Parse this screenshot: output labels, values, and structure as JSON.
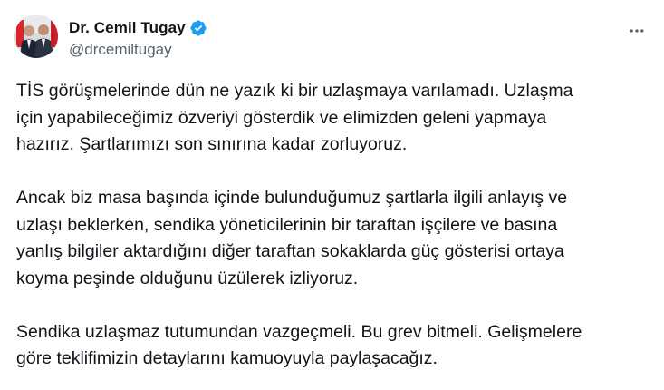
{
  "author": {
    "display_name": "Dr. Cemil Tugay",
    "handle": "@drcemiltugay",
    "verified": true,
    "verified_color": "#1d9bf0"
  },
  "menu": {
    "icon": "more-horizontal-icon"
  },
  "tweet": {
    "paragraphs": [
      "TİS görüşmelerinde dün ne yazık ki bir uzlaşmaya varılamadı. Uzlaşma\niçin yapabileceğimiz özveriyi gösterdik ve elimizden geleni yapmaya\nhazırız. Şartlarımızı son sınırına kadar zorluyoruz.",
      "Ancak biz masa başında içinde bulunduğumuz şartlarla ilgili anlayış ve\nuzlaşı beklerken, sendika yöneticilerinin bir taraftan işçilere ve basına\nyanlış bilgiler aktardığını diğer taraftan sokaklarda güç gösterisi ortaya\nkoyma peşinde olduğunu üzülerek izliyoruz.",
      "Sendika uzlaşmaz tutumundan vazgeçmeli. Bu grev bitmeli. Gelişmelere\ngöre teklifimizin detaylarını kamuoyuyla paylaşacağız."
    ]
  }
}
